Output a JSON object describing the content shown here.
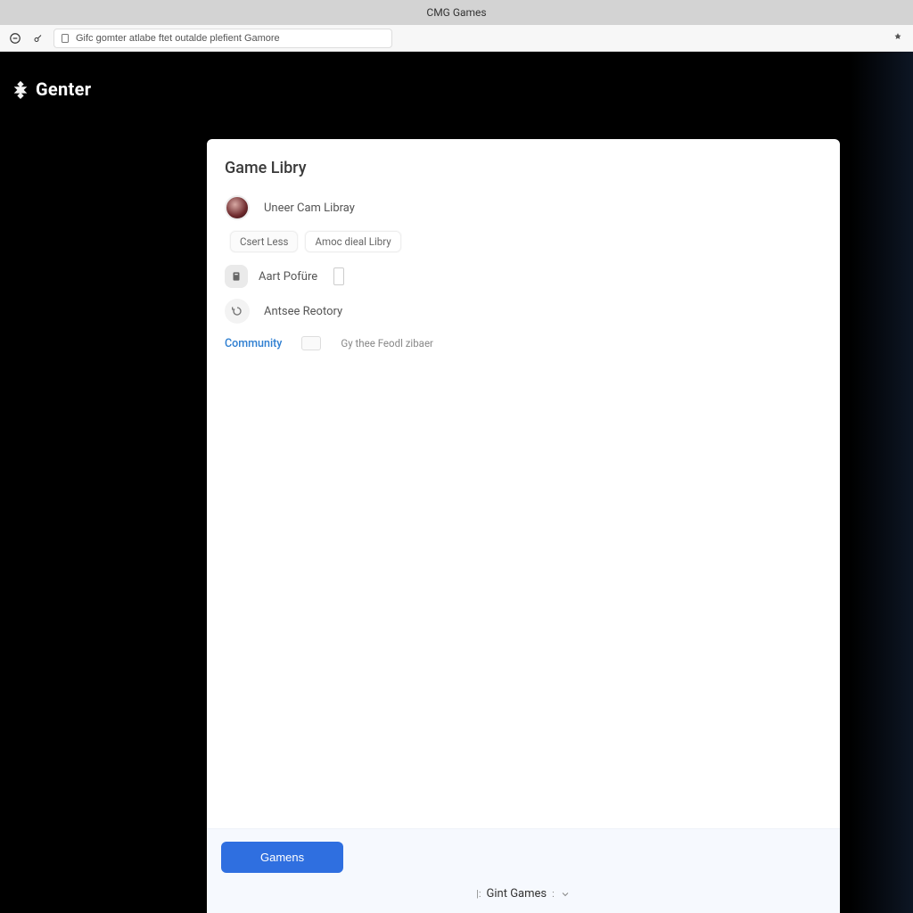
{
  "window": {
    "title": "CMG Games"
  },
  "address": {
    "text": "Gifc gomter atlabe ftet outalde plefient Gamore"
  },
  "brand": {
    "name": "Genter"
  },
  "modal": {
    "title": "Game Libry",
    "user_row": {
      "label": "Uneer Cam Libray"
    },
    "chips": [
      "Csert Less",
      "Amoc dieal Libry"
    ],
    "profile_row": {
      "label": "Aart Pofüre"
    },
    "history_row": {
      "label": "Antsee Reotory"
    },
    "community": {
      "label": "Community",
      "hint": "Gy thee Feodl zibaer"
    }
  },
  "footer": {
    "primary": "Gamens",
    "caption_prefix": "|:",
    "caption": "Gint Games",
    "caption_suffix": ":"
  }
}
